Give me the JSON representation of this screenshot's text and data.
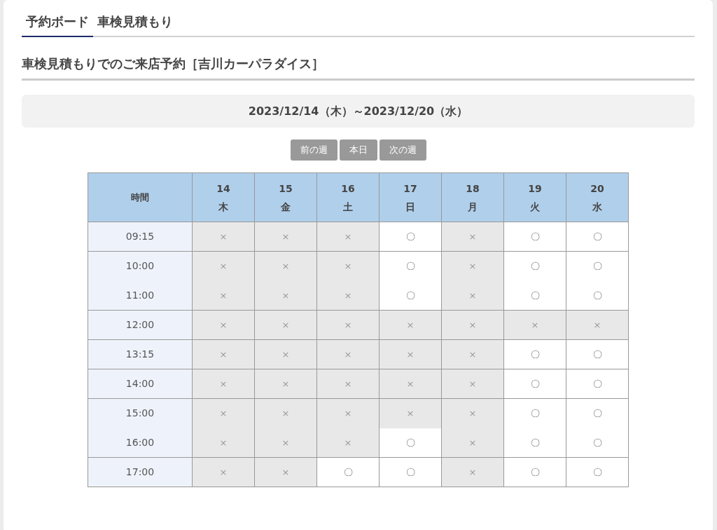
{
  "tabs": [
    {
      "label": "予約ボード",
      "selected": true
    },
    {
      "label": "車検見積もり",
      "selected": false
    }
  ],
  "heading": "車検見積もりでのご来店予約［吉川カーパラダイス］",
  "date_range": "2023/12/14（木）～2023/12/20（水）",
  "nav_buttons": [
    "前の週",
    "本日",
    "次の週"
  ],
  "table": {
    "time_header": "時間",
    "days": [
      {
        "date": "14",
        "weekday": "木"
      },
      {
        "date": "15",
        "weekday": "金"
      },
      {
        "date": "16",
        "weekday": "土"
      },
      {
        "date": "17",
        "weekday": "日"
      },
      {
        "date": "18",
        "weekday": "月"
      },
      {
        "date": "19",
        "weekday": "火"
      },
      {
        "date": "20",
        "weekday": "水"
      }
    ],
    "groups": [
      {
        "rows": [
          {
            "time": "09:15",
            "slots": [
              {
                "mark": "×",
                "available": false
              },
              {
                "mark": "×",
                "available": false
              },
              {
                "mark": "×",
                "available": false
              },
              {
                "mark": "〇",
                "available": true
              },
              {
                "mark": "×",
                "available": false
              },
              {
                "mark": "〇",
                "available": true
              },
              {
                "mark": "〇",
                "available": true
              }
            ]
          }
        ]
      },
      {
        "rows": [
          {
            "time": "10:00",
            "slots": [
              {
                "mark": "×",
                "available": false
              },
              {
                "mark": "×",
                "available": false
              },
              {
                "mark": "×",
                "available": false
              },
              {
                "mark": "〇",
                "available": true
              },
              {
                "mark": "×",
                "available": false
              },
              {
                "mark": "〇",
                "available": true
              },
              {
                "mark": "〇",
                "available": true
              }
            ]
          },
          {
            "time": "11:00",
            "slots": [
              {
                "mark": "×",
                "available": false
              },
              {
                "mark": "×",
                "available": false
              },
              {
                "mark": "×",
                "available": false
              },
              {
                "mark": "〇",
                "available": true
              },
              {
                "mark": "×",
                "available": false
              },
              {
                "mark": "〇",
                "available": true
              },
              {
                "mark": "〇",
                "available": true
              }
            ]
          }
        ]
      },
      {
        "rows": [
          {
            "time": "12:00",
            "slots": [
              {
                "mark": "×",
                "available": false
              },
              {
                "mark": "×",
                "available": false
              },
              {
                "mark": "×",
                "available": false
              },
              {
                "mark": "×",
                "available": false
              },
              {
                "mark": "×",
                "available": false
              },
              {
                "mark": "×",
                "available": false
              },
              {
                "mark": "×",
                "available": false
              }
            ]
          }
        ]
      },
      {
        "rows": [
          {
            "time": "13:15",
            "slots": [
              {
                "mark": "×",
                "available": false
              },
              {
                "mark": "×",
                "available": false
              },
              {
                "mark": "×",
                "available": false
              },
              {
                "mark": "×",
                "available": false
              },
              {
                "mark": "×",
                "available": false
              },
              {
                "mark": "〇",
                "available": true
              },
              {
                "mark": "〇",
                "available": true
              }
            ]
          }
        ]
      },
      {
        "rows": [
          {
            "time": "14:00",
            "slots": [
              {
                "mark": "×",
                "available": false
              },
              {
                "mark": "×",
                "available": false
              },
              {
                "mark": "×",
                "available": false
              },
              {
                "mark": "×",
                "available": false
              },
              {
                "mark": "×",
                "available": false
              },
              {
                "mark": "〇",
                "available": true
              },
              {
                "mark": "〇",
                "available": true
              }
            ]
          }
        ]
      },
      {
        "rows": [
          {
            "time": "15:00",
            "slots": [
              {
                "mark": "×",
                "available": false
              },
              {
                "mark": "×",
                "available": false
              },
              {
                "mark": "×",
                "available": false
              },
              {
                "mark": "×",
                "available": false
              },
              {
                "mark": "×",
                "available": false
              },
              {
                "mark": "〇",
                "available": true
              },
              {
                "mark": "〇",
                "available": true
              }
            ]
          },
          {
            "time": "16:00",
            "slots": [
              {
                "mark": "×",
                "available": false
              },
              {
                "mark": "×",
                "available": false
              },
              {
                "mark": "×",
                "available": false
              },
              {
                "mark": "〇",
                "available": true
              },
              {
                "mark": "×",
                "available": false
              },
              {
                "mark": "〇",
                "available": true
              },
              {
                "mark": "〇",
                "available": true
              }
            ]
          }
        ]
      },
      {
        "rows": [
          {
            "time": "17:00",
            "slots": [
              {
                "mark": "×",
                "available": false
              },
              {
                "mark": "×",
                "available": false
              },
              {
                "mark": "〇",
                "available": true
              },
              {
                "mark": "〇",
                "available": true
              },
              {
                "mark": "×",
                "available": false
              },
              {
                "mark": "〇",
                "available": true
              },
              {
                "mark": "〇",
                "available": true
              }
            ]
          }
        ]
      }
    ]
  }
}
